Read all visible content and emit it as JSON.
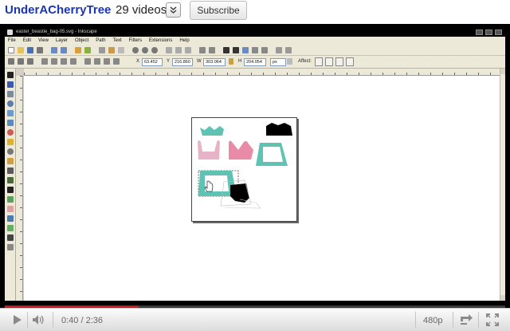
{
  "channel": {
    "name": "UnderACherryTree",
    "video_count": "29 videos",
    "subscribe_label": "Subscribe"
  },
  "inkscape": {
    "title": "easter_beastie_bag-05.svg - Inkscape",
    "menus": [
      "File",
      "Edit",
      "View",
      "Layer",
      "Object",
      "Path",
      "Text",
      "Filters",
      "Extensions",
      "Help"
    ],
    "coords": {
      "x_label": "X",
      "x_value": "63.452",
      "y_label": "Y",
      "y_value": "216.860",
      "w_label": "W",
      "w_value": "303.064",
      "h_label": "H",
      "h_value": "204.054",
      "unit": "px"
    },
    "affect_label": "Affect:"
  },
  "player": {
    "current_time": "0:40",
    "time_separator": "/",
    "duration": "2:36",
    "progress": 0.268,
    "quality": "480p"
  },
  "colors": {
    "channel_link": "#1a35b8",
    "progress_red": "#cc181e",
    "teal": "#5fc3b4",
    "pink": "#e88aa8",
    "light_pink": "#e6b4c6"
  }
}
